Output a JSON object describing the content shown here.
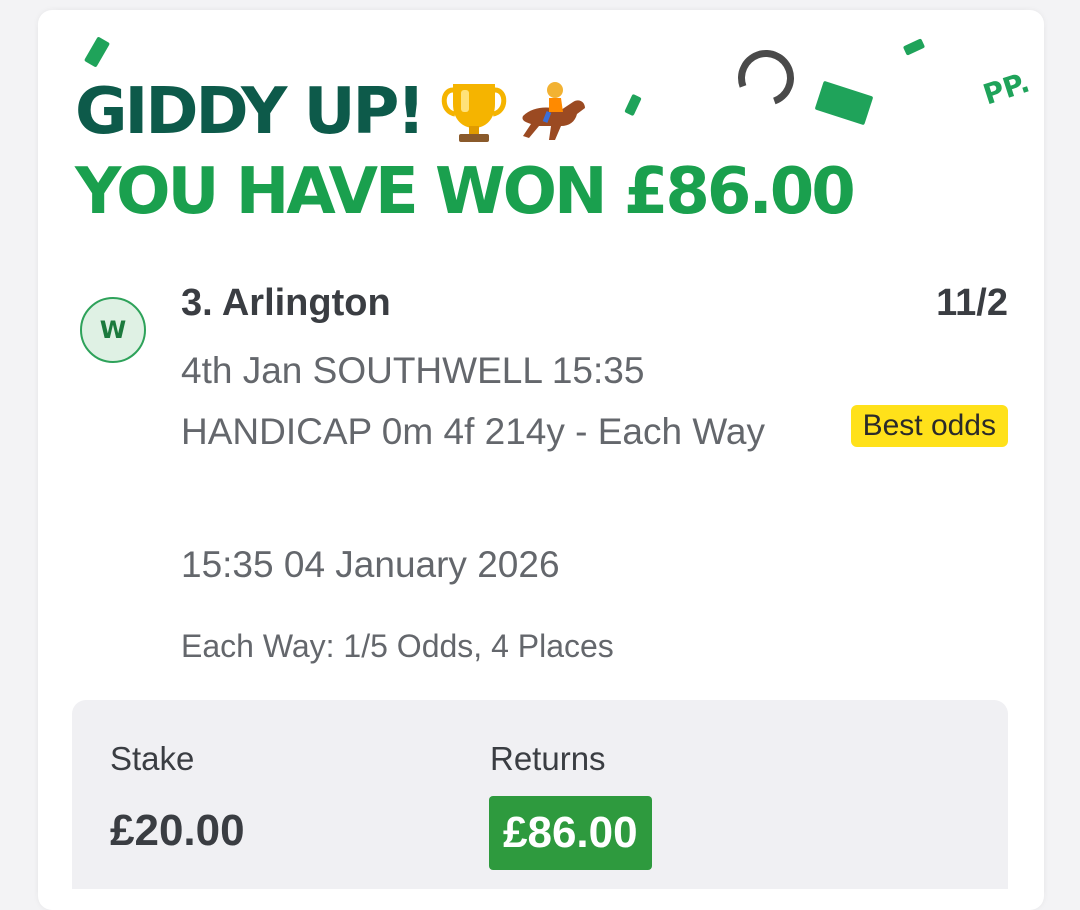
{
  "banner": {
    "line1": "GIDDY UP!",
    "line2": "YOU HAVE WON £86.00",
    "trophy_icon": "trophy-icon",
    "horse_icon": "horse-racing-icon",
    "corner_mark": "PP."
  },
  "selection": {
    "result_badge": "W",
    "name": "3. Arlington",
    "odds": "11/2",
    "event": "4th Jan SOUTHWELL 15:35 HANDICAP 0m 4f 214y - Each Way",
    "best_odds_label": "Best odds",
    "datetime": "15:35 04 January 2026",
    "each_way_terms": "Each Way: 1/5 Odds, 4 Places"
  },
  "summary": {
    "stake_label": "Stake",
    "stake_value": "£20.00",
    "returns_label": "Returns",
    "returns_value": "£86.00"
  },
  "colors": {
    "headline_dark": "#0d5a4a",
    "headline_green": "#1aa04e",
    "best_odds_bg": "#ffe11a",
    "returns_bg": "#2e9a3e"
  }
}
